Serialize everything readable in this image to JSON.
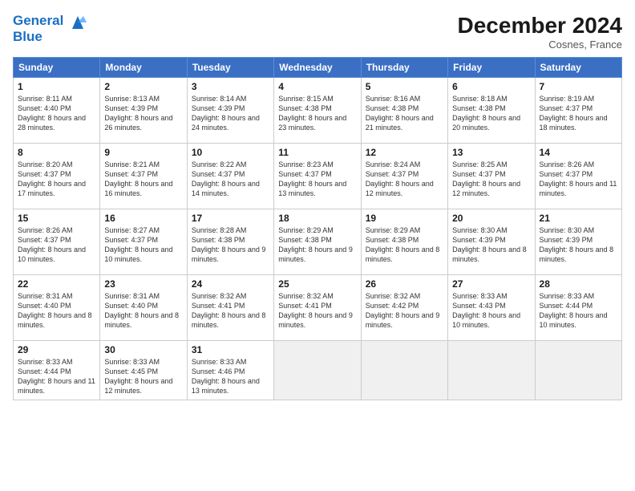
{
  "header": {
    "logo_line1": "General",
    "logo_line2": "Blue",
    "month": "December 2024",
    "location": "Cosnes, France"
  },
  "days_of_week": [
    "Sunday",
    "Monday",
    "Tuesday",
    "Wednesday",
    "Thursday",
    "Friday",
    "Saturday"
  ],
  "weeks": [
    [
      {
        "day": 1,
        "sunrise": "8:11 AM",
        "sunset": "4:40 PM",
        "daylight": "8 hours and 28 minutes."
      },
      {
        "day": 2,
        "sunrise": "8:13 AM",
        "sunset": "4:39 PM",
        "daylight": "8 hours and 26 minutes."
      },
      {
        "day": 3,
        "sunrise": "8:14 AM",
        "sunset": "4:39 PM",
        "daylight": "8 hours and 24 minutes."
      },
      {
        "day": 4,
        "sunrise": "8:15 AM",
        "sunset": "4:38 PM",
        "daylight": "8 hours and 23 minutes."
      },
      {
        "day": 5,
        "sunrise": "8:16 AM",
        "sunset": "4:38 PM",
        "daylight": "8 hours and 21 minutes."
      },
      {
        "day": 6,
        "sunrise": "8:18 AM",
        "sunset": "4:38 PM",
        "daylight": "8 hours and 20 minutes."
      },
      {
        "day": 7,
        "sunrise": "8:19 AM",
        "sunset": "4:37 PM",
        "daylight": "8 hours and 18 minutes."
      }
    ],
    [
      {
        "day": 8,
        "sunrise": "8:20 AM",
        "sunset": "4:37 PM",
        "daylight": "8 hours and 17 minutes."
      },
      {
        "day": 9,
        "sunrise": "8:21 AM",
        "sunset": "4:37 PM",
        "daylight": "8 hours and 16 minutes."
      },
      {
        "day": 10,
        "sunrise": "8:22 AM",
        "sunset": "4:37 PM",
        "daylight": "8 hours and 14 minutes."
      },
      {
        "day": 11,
        "sunrise": "8:23 AM",
        "sunset": "4:37 PM",
        "daylight": "8 hours and 13 minutes."
      },
      {
        "day": 12,
        "sunrise": "8:24 AM",
        "sunset": "4:37 PM",
        "daylight": "8 hours and 12 minutes."
      },
      {
        "day": 13,
        "sunrise": "8:25 AM",
        "sunset": "4:37 PM",
        "daylight": "8 hours and 12 minutes."
      },
      {
        "day": 14,
        "sunrise": "8:26 AM",
        "sunset": "4:37 PM",
        "daylight": "8 hours and 11 minutes."
      }
    ],
    [
      {
        "day": 15,
        "sunrise": "8:26 AM",
        "sunset": "4:37 PM",
        "daylight": "8 hours and 10 minutes."
      },
      {
        "day": 16,
        "sunrise": "8:27 AM",
        "sunset": "4:37 PM",
        "daylight": "8 hours and 10 minutes."
      },
      {
        "day": 17,
        "sunrise": "8:28 AM",
        "sunset": "4:38 PM",
        "daylight": "8 hours and 9 minutes."
      },
      {
        "day": 18,
        "sunrise": "8:29 AM",
        "sunset": "4:38 PM",
        "daylight": "8 hours and 9 minutes."
      },
      {
        "day": 19,
        "sunrise": "8:29 AM",
        "sunset": "4:38 PM",
        "daylight": "8 hours and 8 minutes."
      },
      {
        "day": 20,
        "sunrise": "8:30 AM",
        "sunset": "4:39 PM",
        "daylight": "8 hours and 8 minutes."
      },
      {
        "day": 21,
        "sunrise": "8:30 AM",
        "sunset": "4:39 PM",
        "daylight": "8 hours and 8 minutes."
      }
    ],
    [
      {
        "day": 22,
        "sunrise": "8:31 AM",
        "sunset": "4:40 PM",
        "daylight": "8 hours and 8 minutes."
      },
      {
        "day": 23,
        "sunrise": "8:31 AM",
        "sunset": "4:40 PM",
        "daylight": "8 hours and 8 minutes."
      },
      {
        "day": 24,
        "sunrise": "8:32 AM",
        "sunset": "4:41 PM",
        "daylight": "8 hours and 8 minutes."
      },
      {
        "day": 25,
        "sunrise": "8:32 AM",
        "sunset": "4:41 PM",
        "daylight": "8 hours and 9 minutes."
      },
      {
        "day": 26,
        "sunrise": "8:32 AM",
        "sunset": "4:42 PM",
        "daylight": "8 hours and 9 minutes."
      },
      {
        "day": 27,
        "sunrise": "8:33 AM",
        "sunset": "4:43 PM",
        "daylight": "8 hours and 10 minutes."
      },
      {
        "day": 28,
        "sunrise": "8:33 AM",
        "sunset": "4:44 PM",
        "daylight": "8 hours and 10 minutes."
      }
    ],
    [
      {
        "day": 29,
        "sunrise": "8:33 AM",
        "sunset": "4:44 PM",
        "daylight": "8 hours and 11 minutes."
      },
      {
        "day": 30,
        "sunrise": "8:33 AM",
        "sunset": "4:45 PM",
        "daylight": "8 hours and 12 minutes."
      },
      {
        "day": 31,
        "sunrise": "8:33 AM",
        "sunset": "4:46 PM",
        "daylight": "8 hours and 13 minutes."
      },
      null,
      null,
      null,
      null
    ]
  ]
}
